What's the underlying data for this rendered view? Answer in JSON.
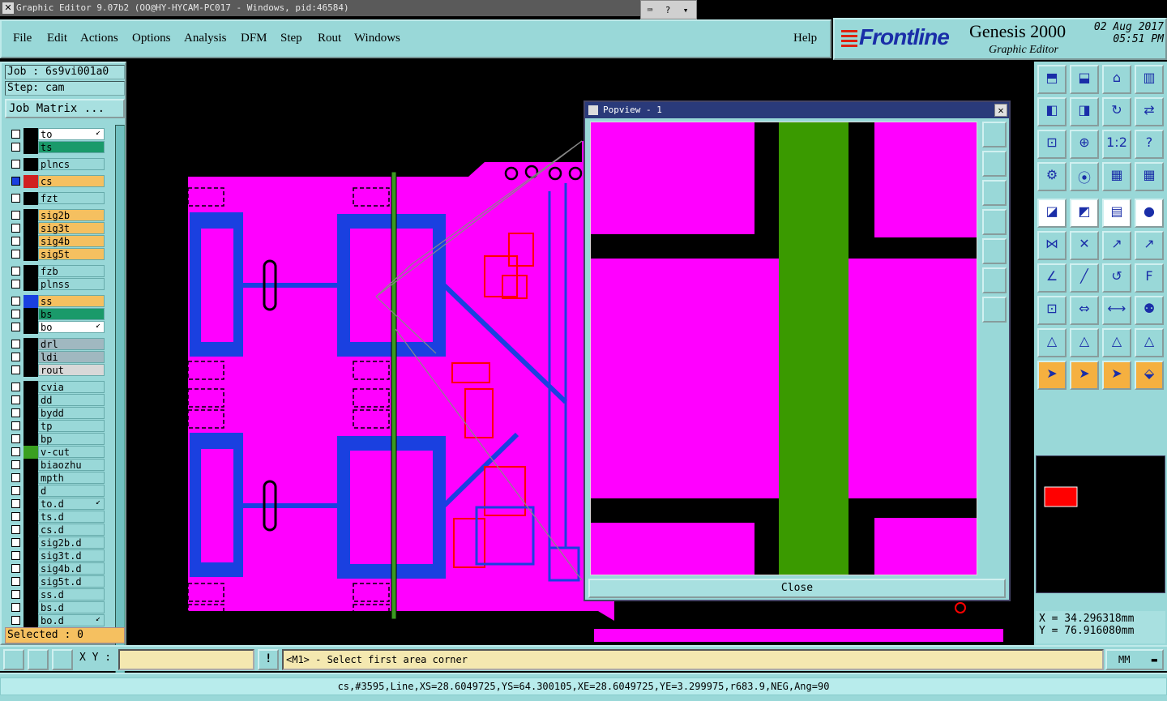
{
  "window": {
    "title": "Graphic Editor 9.07b2 (OO@HY-HYCAM-PC017 - Windows, pid:46584)"
  },
  "menu": {
    "items": [
      "File",
      "Edit",
      "Actions",
      "Options",
      "Analysis",
      "DFM",
      "Step",
      "Rout",
      "Windows"
    ],
    "help": "Help"
  },
  "brand": {
    "logo": "Frontline",
    "product": "Genesis 2000",
    "subtitle": "Graphic Editor",
    "date": "02 Aug 2017",
    "time": "05:51 PM"
  },
  "job": {
    "job_label": "Job : 6s9vi001a0",
    "step_label": "Step: cam",
    "matrix_button": "Job Matrix ..."
  },
  "layers": [
    {
      "name": "to",
      "color": "#ffffff",
      "swatch": "#000000",
      "mark": "↙"
    },
    {
      "name": "ts",
      "color": "#1a9a6a",
      "swatch": "#000000"
    },
    {
      "name": "plncs",
      "color": "#99d8d8",
      "swatch": "#000000"
    },
    {
      "name": "cs",
      "color": "#f5c060",
      "swatch": "#d02020",
      "active": true
    },
    {
      "name": "fzt",
      "color": "#99d8d8",
      "swatch": "#000000"
    },
    {
      "name": "sig2b",
      "color": "#f5c060",
      "swatch": "#000000"
    },
    {
      "name": "sig3t",
      "color": "#f5c060",
      "swatch": "#000000"
    },
    {
      "name": "sig4b",
      "color": "#f5c060",
      "swatch": "#000000"
    },
    {
      "name": "sig5t",
      "color": "#f5c060",
      "swatch": "#000000"
    },
    {
      "name": "fzb",
      "color": "#99d8d8",
      "swatch": "#000000"
    },
    {
      "name": "plnss",
      "color": "#99d8d8",
      "swatch": "#000000"
    },
    {
      "name": "ss",
      "color": "#f5c060",
      "swatch": "#1a40e0"
    },
    {
      "name": "bs",
      "color": "#1a9a6a",
      "swatch": "#000000"
    },
    {
      "name": "bo",
      "color": "#ffffff",
      "swatch": "#000000",
      "mark": "↙"
    },
    {
      "name": "drl",
      "color": "#a0b8c0",
      "swatch": "#000000"
    },
    {
      "name": "ldi",
      "color": "#a0b8c0",
      "swatch": "#000000"
    },
    {
      "name": "rout",
      "color": "#d8d8d8",
      "swatch": "#000000"
    },
    {
      "name": "cvia",
      "color": "#99d8d8",
      "swatch": "#000000"
    },
    {
      "name": "dd",
      "color": "#99d8d8",
      "swatch": "#000000"
    },
    {
      "name": "bydd",
      "color": "#99d8d8",
      "swatch": "#000000"
    },
    {
      "name": "tp",
      "color": "#99d8d8",
      "swatch": "#000000"
    },
    {
      "name": "bp",
      "color": "#99d8d8",
      "swatch": "#000000"
    },
    {
      "name": "v-cut",
      "color": "#99d8d8",
      "swatch": "#3aa020"
    },
    {
      "name": "biaozhu",
      "color": "#99d8d8",
      "swatch": "#000000"
    },
    {
      "name": "mpth",
      "color": "#99d8d8",
      "swatch": "#000000"
    },
    {
      "name": "d",
      "color": "#99d8d8",
      "swatch": "#000000"
    },
    {
      "name": "to.d",
      "color": "#99d8d8",
      "swatch": "#000000",
      "mark": "↙"
    },
    {
      "name": "ts.d",
      "color": "#99d8d8",
      "swatch": "#000000"
    },
    {
      "name": "cs.d",
      "color": "#99d8d8",
      "swatch": "#000000"
    },
    {
      "name": "sig2b.d",
      "color": "#99d8d8",
      "swatch": "#000000"
    },
    {
      "name": "sig3t.d",
      "color": "#99d8d8",
      "swatch": "#000000"
    },
    {
      "name": "sig4b.d",
      "color": "#99d8d8",
      "swatch": "#000000"
    },
    {
      "name": "sig5t.d",
      "color": "#99d8d8",
      "swatch": "#000000"
    },
    {
      "name": "ss.d",
      "color": "#99d8d8",
      "swatch": "#000000"
    },
    {
      "name": "bs.d",
      "color": "#99d8d8",
      "swatch": "#000000"
    },
    {
      "name": "bo.d",
      "color": "#99d8d8",
      "swatch": "#000000",
      "mark": "↙"
    }
  ],
  "selected": "Selected : 0",
  "popview": {
    "title": "Popview - 1",
    "close_button": "Close"
  },
  "coords": {
    "x": "X = 34.296318mm",
    "y": "Y = 76.916080mm"
  },
  "bottom": {
    "xy_label": "X Y :",
    "xy_value": "",
    "prompt": "<M1> - Select first area corner",
    "units": "MM"
  },
  "status": "cs,#3595,Line,XS=28.6049725,YS=64.300105,XE=28.6049725,YE=3.299975,r683.9,NEG,Ang=90"
}
